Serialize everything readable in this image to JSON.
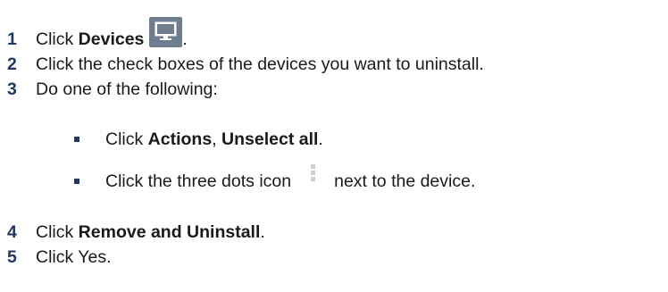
{
  "steps": [
    {
      "number": "1",
      "pre": "Click ",
      "bold": "Devices",
      "post": ".",
      "icon": "monitor-icon"
    },
    {
      "number": "2",
      "text": "Click the check boxes of the devices you want to uninstall."
    },
    {
      "number": "3",
      "text": "Do one of the following:"
    },
    {
      "number": "4",
      "pre": "Click ",
      "bold": "Remove and Uninstall",
      "post": "."
    },
    {
      "number": "5",
      "text": "Click Yes."
    }
  ],
  "substeps": [
    {
      "pre": "Click ",
      "bold1": "Actions",
      "sep": ", ",
      "bold2": "Unselect all",
      "post": "."
    },
    {
      "pre": "Click the three dots icon",
      "post": "next to the device.",
      "icon": "three-dots-icon"
    }
  ]
}
